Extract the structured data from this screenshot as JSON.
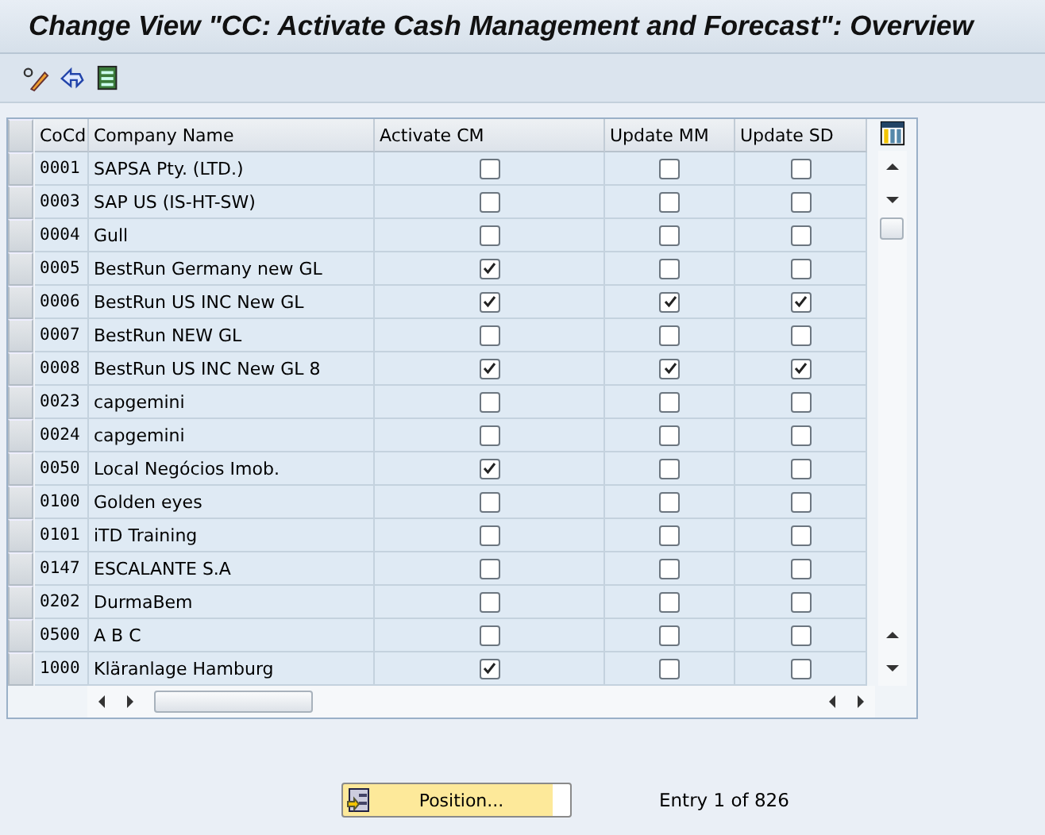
{
  "window": {
    "title": "Change View \"CC: Activate Cash Management and Forecast\": Overview"
  },
  "table": {
    "columns": [
      "CoCd",
      "Company Name",
      "Activate CM",
      "Update MM",
      "Update SD"
    ],
    "rows": [
      {
        "cocd": "0001",
        "name": "SAPSA Pty. (LTD.)",
        "activate_cm": false,
        "update_mm": false,
        "update_sd": false
      },
      {
        "cocd": "0003",
        "name": "SAP US (IS-HT-SW)",
        "activate_cm": false,
        "update_mm": false,
        "update_sd": false
      },
      {
        "cocd": "0004",
        "name": "Gull",
        "activate_cm": false,
        "update_mm": false,
        "update_sd": false
      },
      {
        "cocd": "0005",
        "name": "BestRun Germany new GL",
        "activate_cm": true,
        "update_mm": false,
        "update_sd": false
      },
      {
        "cocd": "0006",
        "name": "BestRun US INC New GL",
        "activate_cm": true,
        "update_mm": true,
        "update_sd": true
      },
      {
        "cocd": "0007",
        "name": "BestRun NEW GL",
        "activate_cm": false,
        "update_mm": false,
        "update_sd": false
      },
      {
        "cocd": "0008",
        "name": "BestRun US INC New GL 8",
        "activate_cm": true,
        "update_mm": true,
        "update_sd": true
      },
      {
        "cocd": "0023",
        "name": "capgemini",
        "activate_cm": false,
        "update_mm": false,
        "update_sd": false
      },
      {
        "cocd": "0024",
        "name": "capgemini",
        "activate_cm": false,
        "update_mm": false,
        "update_sd": false
      },
      {
        "cocd": "0050",
        "name": "Local Negócios Imob.",
        "activate_cm": true,
        "update_mm": false,
        "update_sd": false
      },
      {
        "cocd": "0100",
        "name": "Golden eyes",
        "activate_cm": false,
        "update_mm": false,
        "update_sd": false
      },
      {
        "cocd": "0101",
        "name": "iTD Training",
        "activate_cm": false,
        "update_mm": false,
        "update_sd": false
      },
      {
        "cocd": "0147",
        "name": "ESCALANTE S.A",
        "activate_cm": false,
        "update_mm": false,
        "update_sd": false
      },
      {
        "cocd": "0202",
        "name": "DurmaBem",
        "activate_cm": false,
        "update_mm": false,
        "update_sd": false
      },
      {
        "cocd": "0500",
        "name": "A B C",
        "activate_cm": false,
        "update_mm": false,
        "update_sd": false
      },
      {
        "cocd": "1000",
        "name": "Kläranlage Hamburg",
        "activate_cm": true,
        "update_mm": false,
        "update_sd": false
      }
    ]
  },
  "position_button": "Position...",
  "entry_info": "Entry 1 of 826"
}
